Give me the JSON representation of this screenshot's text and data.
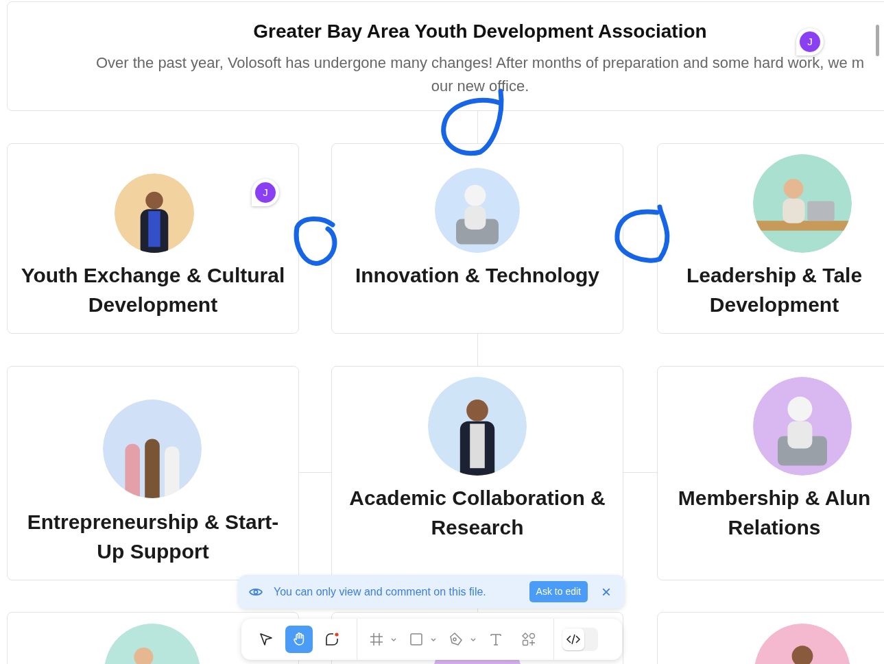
{
  "header": {
    "title": "Greater Bay Area Youth Development Association",
    "description_lines": [
      "Over the past year, Volosoft has undergone many changes! After months of preparation and some hard work, we m",
      "our new office."
    ]
  },
  "cards": [
    {
      "title": "Youth Exchange & Cultural Development",
      "kind": "titled"
    },
    {
      "title": "Innovation & Technology",
      "kind": "titled"
    },
    {
      "title": "Leadership & Tale Development",
      "kind": "titled"
    },
    {
      "title": "Entrepreneurship & Start-Up Support",
      "kind": "titled"
    },
    {
      "title": "Academic Collaboration & Research",
      "kind": "titled"
    },
    {
      "title": "Membership & Alun Relations",
      "kind": "titled"
    },
    {
      "kind": "picture_only"
    },
    {
      "kind": "picture_only"
    },
    {
      "kind": "picture_only"
    }
  ],
  "comment_pins": [
    {
      "initial": "J"
    },
    {
      "initial": "J"
    }
  ],
  "banner": {
    "message": "You can only view and comment on this file.",
    "action": "Ask to edit",
    "close": "×"
  },
  "tools": [
    {
      "kind": "move",
      "selected": false
    },
    {
      "kind": "hand",
      "selected": true
    },
    {
      "kind": "comment",
      "selected": false
    },
    {
      "kind": "frame",
      "selected": false
    },
    {
      "kind": "rectangle",
      "selected": false
    },
    {
      "kind": "pen",
      "selected": false
    },
    {
      "kind": "text",
      "selected": false
    },
    {
      "kind": "components",
      "selected": false
    },
    {
      "kind": "code",
      "selected": false
    }
  ]
}
